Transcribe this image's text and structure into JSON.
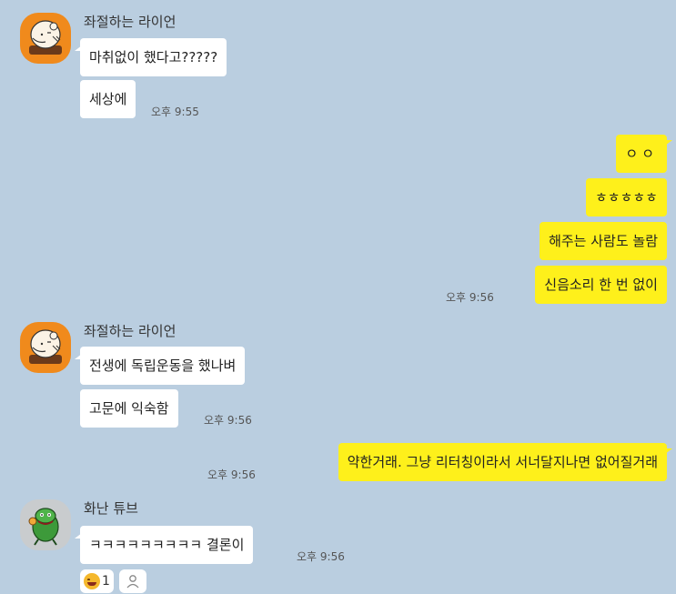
{
  "chat": {
    "block1": {
      "sender": "좌절하는 라이언",
      "msg1": "마취없이 했다고?????",
      "msg2": "세상에",
      "time": "오후 9:55"
    },
    "mine1": {
      "msg1": "ㅇㅇ",
      "msg2": "ㅎㅎㅎㅎㅎ",
      "msg3": "해주는 사람도 놀람",
      "msg4": "신음소리 한 번 없이",
      "time": "오후 9:56"
    },
    "block2": {
      "sender": "좌절하는 라이언",
      "msg1": "전생에 독립운동을 했나벼",
      "msg2": "고문에 익숙함",
      "time": "오후 9:56"
    },
    "mine2": {
      "msg1": "약한거래. 그냥 리터칭이라서 서너달지나면 없어질거래",
      "time": "오후 9:56"
    },
    "block3": {
      "sender": "화난 튜브",
      "msg1": "ㅋㅋㅋㅋㅋㅋㅋㅋㅋ 결론이",
      "time": "오후 9:56",
      "reaction_count": "1"
    }
  },
  "icons": {
    "lion_avatar": "ryan-character-icon",
    "tube_avatar": "tube-character-icon",
    "reaction_emoji": "laughing-emoji-icon",
    "add_reaction": "person-icon"
  },
  "colors": {
    "background": "#bacee0",
    "my_bubble": "#fef01b",
    "their_bubble": "#ffffff",
    "lion_avatar_bg": "#f08a1c"
  }
}
